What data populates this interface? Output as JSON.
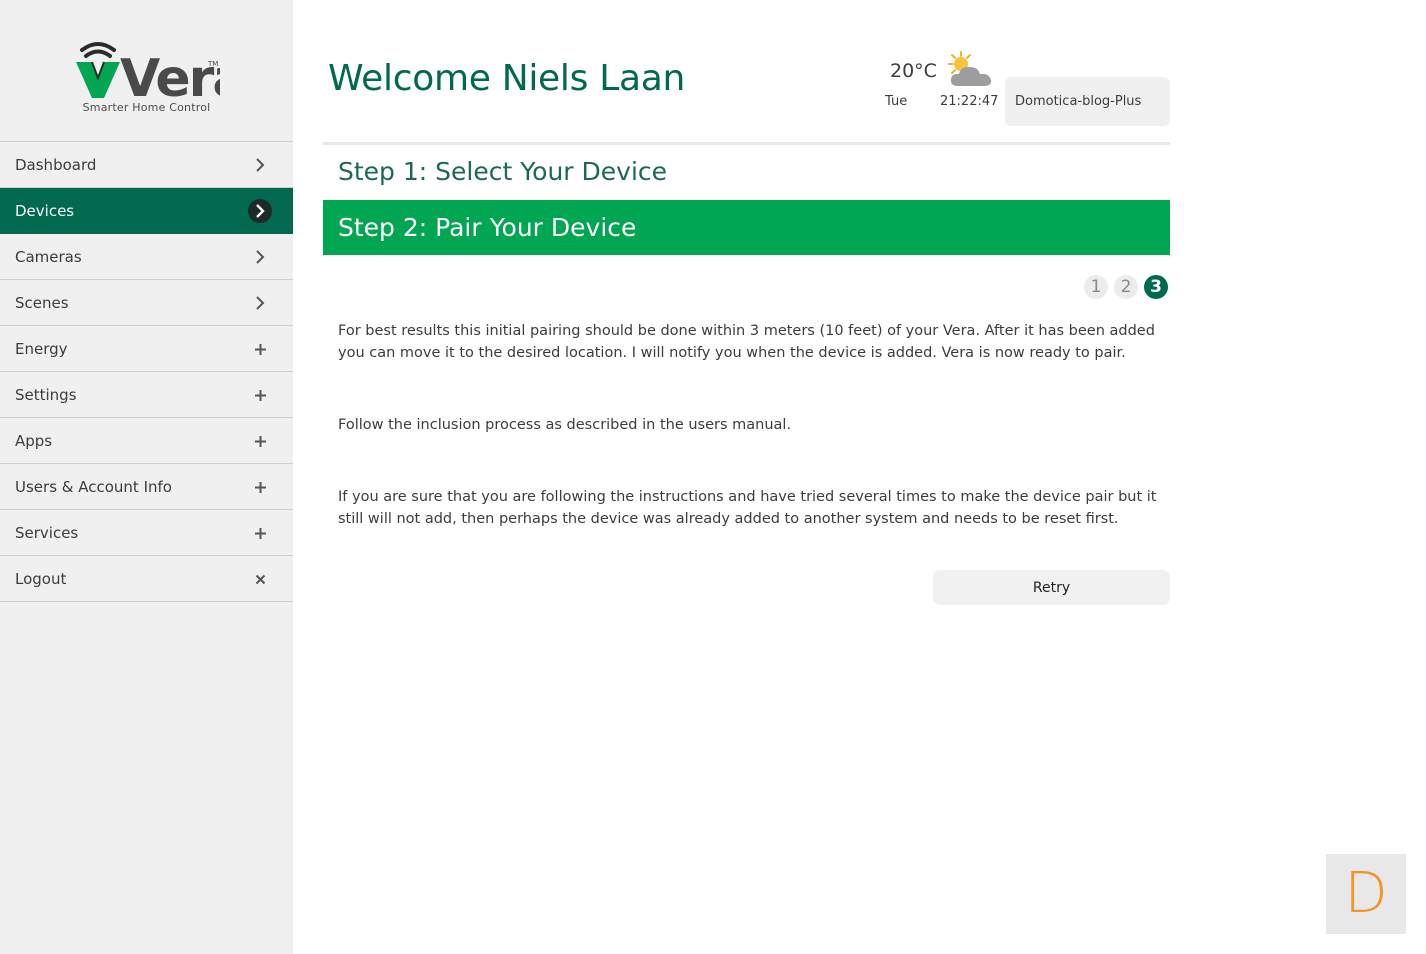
{
  "brand": {
    "name": "Vera",
    "trademark": "TM",
    "tagline": "Smarter Home Control"
  },
  "nav": [
    {
      "label": "Dashboard",
      "icon": "chevron-right-icon",
      "active": false
    },
    {
      "label": "Devices",
      "icon": "chevron-right-icon",
      "active": true
    },
    {
      "label": "Cameras",
      "icon": "chevron-right-icon",
      "active": false
    },
    {
      "label": "Scenes",
      "icon": "chevron-right-icon",
      "active": false
    },
    {
      "label": "Energy",
      "icon": "plus-icon",
      "active": false
    },
    {
      "label": "Settings",
      "icon": "plus-icon",
      "active": false
    },
    {
      "label": "Apps",
      "icon": "plus-icon",
      "active": false
    },
    {
      "label": "Users & Account Info",
      "icon": "plus-icon",
      "active": false
    },
    {
      "label": "Services",
      "icon": "plus-icon",
      "active": false
    },
    {
      "label": "Logout",
      "icon": "close-icon",
      "active": false
    }
  ],
  "header": {
    "title": "Welcome Niels Laan",
    "weather": {
      "temperature": "20°C",
      "day": "Tue",
      "time": "21:22:47",
      "icon": "partly-cloudy-icon"
    },
    "controller": "Domotica-blog-Plus"
  },
  "wizard": {
    "step1": "Step 1: Select Your Device",
    "step2": "Step 2: Pair Your Device",
    "pages": [
      "1",
      "2",
      "3"
    ],
    "current_page": 3,
    "paragraphs": [
      "For best results this initial pairing should be done within 3 meters (10 feet) of your Vera. After it has been added you can move it to the desired location. I will notify you when the device is added. Vera is now ready to pair.",
      "Follow the inclusion process as described in the users manual.",
      "If you are sure that you are following the instructions and have tried several times to make the device pair but it still will not add, then perhaps the device was already added to another system and needs to be reset first."
    ],
    "retry_label": "Retry"
  },
  "corner_badge": "D",
  "colors": {
    "primary": "#00694e",
    "step_active": "#00a651",
    "sidebar": "#f0f0f0",
    "badge_text": "#f0962a"
  }
}
